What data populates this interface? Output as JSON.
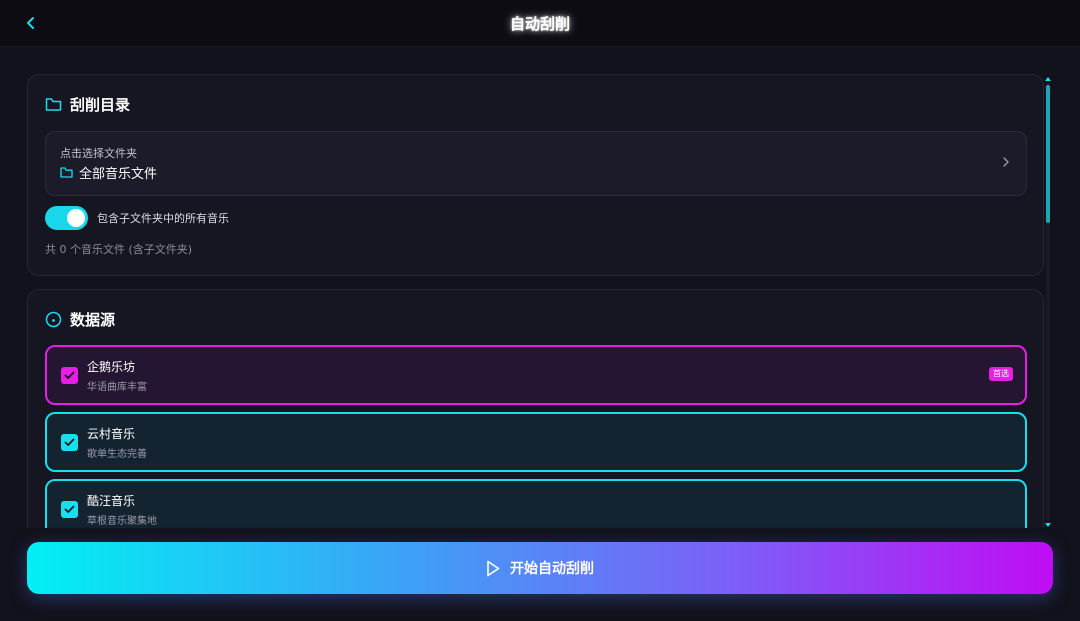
{
  "header": {
    "title": "自动刮削",
    "back_icon": "chevron-left-icon"
  },
  "directory": {
    "title": "刮削目录",
    "picker_hint": "点击选择文件夹",
    "picker_value": "全部音乐文件",
    "include_subfolders_label": "包含子文件夹中的所有音乐",
    "include_subfolders_on": true,
    "count_text": "共 0 个音乐文件 (含子文件夹)"
  },
  "sources": {
    "title": "数据源",
    "items": [
      {
        "name": "企鹅乐坊",
        "desc": "华语曲库丰富",
        "checked": true,
        "badge": "首选",
        "accent": "#e71ee6"
      },
      {
        "name": "云村音乐",
        "desc": "歌单生态完善",
        "checked": true,
        "badge": "",
        "accent": "#16dfee"
      },
      {
        "name": "酷汪音乐",
        "desc": "草根音乐聚集地",
        "checked": true,
        "badge": "",
        "accent": "#16dfee"
      }
    ]
  },
  "action": {
    "start_label": "开始自动刮削",
    "start_icon": "play-icon"
  },
  "colors": {
    "accent_cyan": "#16dfee",
    "accent_magenta": "#e71ee6",
    "background": "#12121c"
  }
}
